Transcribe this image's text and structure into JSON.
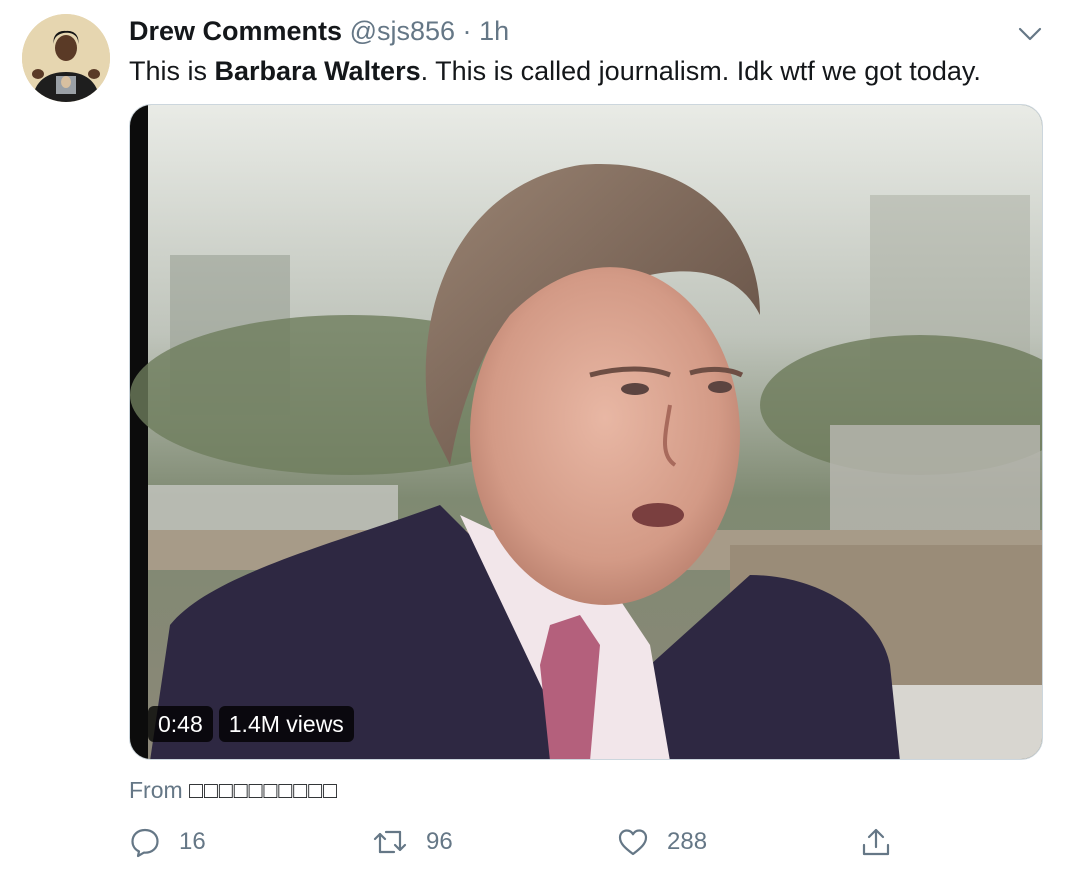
{
  "author": {
    "display_name": "Drew Comments",
    "handle": "@sjs856",
    "separator": "·",
    "time_ago": "1h"
  },
  "tweet": {
    "text_before": "This is ",
    "text_bold": "Barbara Walters",
    "text_after": ". This is called journalism. Idk wtf we got today."
  },
  "media": {
    "duration": "0:48",
    "views": "1.4M views"
  },
  "source": {
    "prefix": "From ",
    "name": "□□□□□□□□□□"
  },
  "actions": {
    "reply_count": "16",
    "retweet_count": "96",
    "like_count": "288"
  },
  "icons": {
    "caret": "chevron-down-icon",
    "reply": "reply-icon",
    "retweet": "retweet-icon",
    "like": "heart-icon",
    "share": "share-icon"
  },
  "colors": {
    "text": "#14171a",
    "secondary": "#657786",
    "border": "#ccd6dd"
  }
}
